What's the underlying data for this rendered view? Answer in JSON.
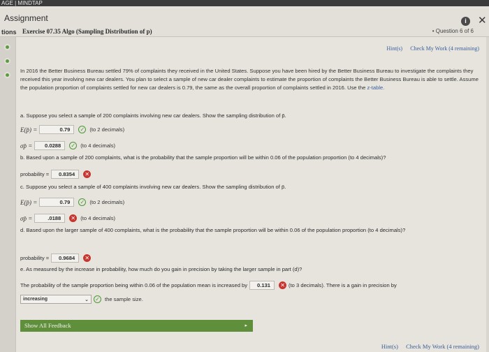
{
  "topstrip": {
    "text": "AGE | MINDTAP"
  },
  "header": {
    "title": "Assignment",
    "tabs_label": "tions",
    "exercise": "Exercise 07.35 Algo (Sampling Distribution of p)",
    "question_counter": "• Question 6 of 6",
    "info_icon": "info-circle-icon",
    "close_icon": "close-icon"
  },
  "hints": {
    "hint_label": "Hint(s)",
    "check_label": "Check My Work (4 remaining)"
  },
  "problem": {
    "intro": "In 2016 the Better Business Bureau settled 79% of complaints they received in the United States. Suppose you have been hired by the Better Business Bureau to investigate the complaints they received this year involving new car dealers. You plan to select a sample of new car dealer complaints to estimate the proportion of complaints the Better Business Bureau is able to settle. Assume the population proportion of complaints settled for new car dealers is 0.79, the same as the overall proportion of complaints settled in 2016. Use the",
    "table_link": "z-table.",
    "part_a": "a. Suppose you select a sample of 200 complaints involving new car dealers. Show the sampling distribution of p̄.",
    "part_b": "b. Based upon a sample of 200 complaints, what is the probability that the sample proportion will be within 0.06 of the population proportion (to 4 decimals)?",
    "part_c": "c. Suppose you select a sample of 400 complaints involving new car dealers. Show the sampling distribution of p̄.",
    "part_d": "d. Based upon the larger sample of 400 complaints, what is the probability that the sample proportion will be within 0.06 of the population proportion (to 4 decimals)?",
    "part_e": "e. As measured by the increase in probability, how much do you gain in precision by taking the larger sample in part (d)?"
  },
  "answers": {
    "ep_label": "E(p̄) =",
    "sigma_label": "σp̄ =",
    "prob_label": "probability =",
    "a_ep": "0.79",
    "a_ep_note": "(to 2 decimals)",
    "a_sigma": "0.0288",
    "a_sigma_note": "(to 4 decimals)",
    "b_prob": "0.8354",
    "c_ep": "0.79",
    "c_ep_note": "(to 2 decimals)",
    "c_sigma": ".0188",
    "c_sigma_note": "(to 4 decimals)",
    "d_prob": "0.9684",
    "e_sentence_start": "The probability of the sample proportion being within 0.06 of the population mean is increased by",
    "e_value": "0.131",
    "e_sentence_end": "(to 3 decimals). There is a gain in precision by",
    "e_select": "increasing",
    "e_select_end": "the sample size.",
    "correct_glyph": "✓",
    "wrong_glyph": "✕"
  },
  "feedback": {
    "label": "Show All Feedback",
    "caret": "▸"
  }
}
